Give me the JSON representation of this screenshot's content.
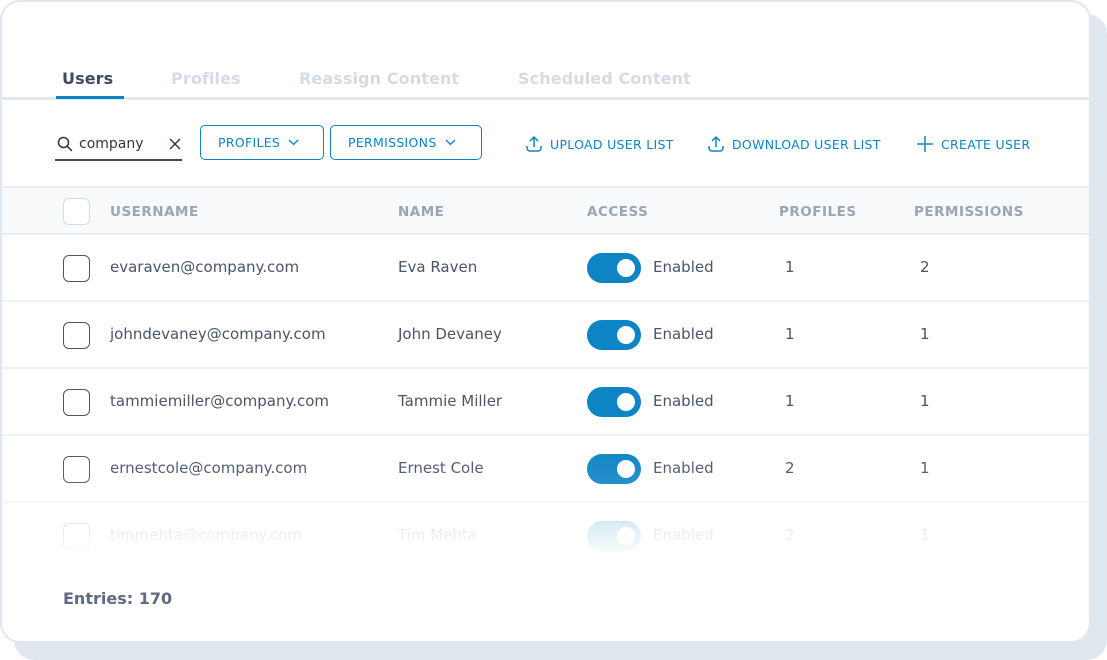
{
  "tabs": [
    {
      "label": "Users",
      "active": true
    },
    {
      "label": "Profiles",
      "active": false
    },
    {
      "label": "Reassign Content",
      "active": false
    },
    {
      "label": "Scheduled Content",
      "active": false
    }
  ],
  "toolbar": {
    "search_value": "company",
    "profiles_label": "PROFILES",
    "permissions_label": "PERMISSIONS",
    "upload_label": "UPLOAD USER LIST",
    "download_label": "DOWNLOAD USER LIST",
    "create_label": "CREATE USER"
  },
  "table": {
    "columns": [
      "USERNAME",
      "NAME",
      "ACCESS",
      "PROFILES",
      "PERMISSIONS"
    ],
    "rows": [
      {
        "username": "evaraven@company.com",
        "name": "Eva Raven",
        "access": "Enabled",
        "enabled": true,
        "profiles": "1",
        "permissions": "2"
      },
      {
        "username": "johndevaney@company.com",
        "name": "John Devaney",
        "access": "Enabled",
        "enabled": true,
        "profiles": "1",
        "permissions": "1"
      },
      {
        "username": "tammiemiller@company.com",
        "name": "Tammie Miller",
        "access": "Enabled",
        "enabled": true,
        "profiles": "1",
        "permissions": "1"
      },
      {
        "username": "ernestcole@company.com",
        "name": "Ernest Cole",
        "access": "Enabled",
        "enabled": true,
        "profiles": "2",
        "permissions": "1"
      },
      {
        "username": "timmehta@company.com",
        "name": "Tim Mehta",
        "access": "Enabled",
        "enabled": true,
        "profiles": "2",
        "permissions": "1"
      }
    ]
  },
  "footer": {
    "entries_label": "Entries: 170"
  },
  "colors": {
    "accent": "#0d84c4",
    "border": "#e1e7ef",
    "text": "#4a5568",
    "inactive_tab": "#d3dbe5"
  }
}
